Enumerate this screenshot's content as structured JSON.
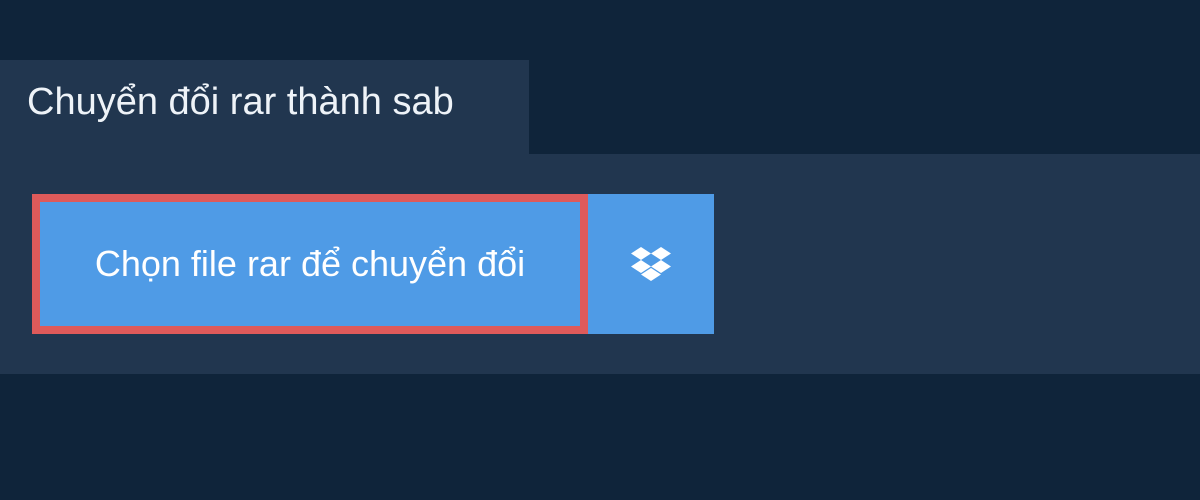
{
  "header": {
    "tab_title": "Chuyển đổi rar thành sab"
  },
  "upload": {
    "choose_label": "Chọn file rar để chuyển đổi",
    "dropbox_icon": "dropbox-icon"
  },
  "colors": {
    "page_bg": "#0f243a",
    "panel_bg": "#21364f",
    "button_bg": "#4f9be6",
    "focus_border": "#de5a5a",
    "text": "#ffffff"
  }
}
